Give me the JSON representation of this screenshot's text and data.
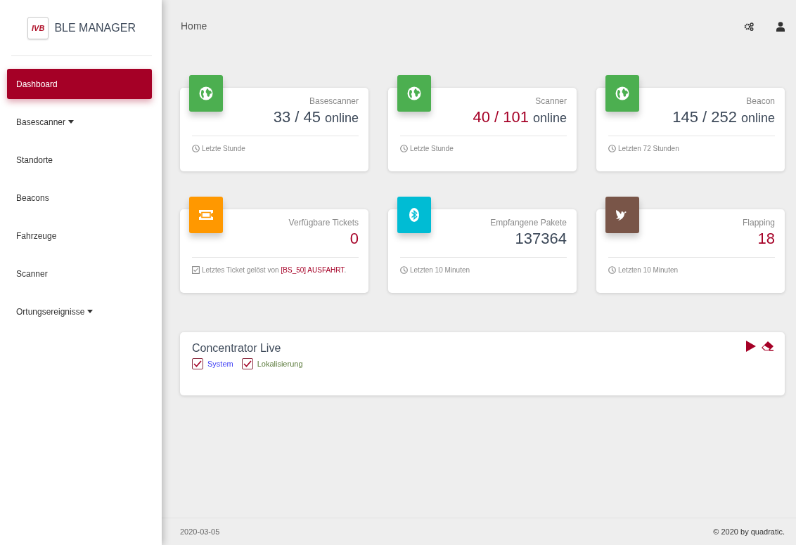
{
  "brand": {
    "logo": "IVB",
    "title": "BLE MANAGER"
  },
  "sidebar": {
    "items": [
      {
        "label": "Dashboard",
        "selected": true,
        "dropdown": false
      },
      {
        "label": "Basescanner",
        "selected": false,
        "dropdown": true
      },
      {
        "label": "Standorte",
        "selected": false,
        "dropdown": false
      },
      {
        "label": "Beacons",
        "selected": false,
        "dropdown": false
      },
      {
        "label": "Fahrzeuge",
        "selected": false,
        "dropdown": false
      },
      {
        "label": "Scanner",
        "selected": false,
        "dropdown": false
      },
      {
        "label": "Ortungsereignisse",
        "selected": false,
        "dropdown": true
      }
    ]
  },
  "header": {
    "title": "Home"
  },
  "cards": [
    {
      "kind": "globe",
      "color": "#4caf50",
      "title": "Basescanner",
      "value": "33 / 45",
      "unit": "online",
      "alert": false,
      "footer": {
        "kind": "clock",
        "text": "Letzte Stunde"
      }
    },
    {
      "kind": "globe",
      "color": "#4caf50",
      "title": "Scanner",
      "value": "40 / 101",
      "unit": "online",
      "alert": true,
      "footer": {
        "kind": "clock",
        "text": "Letzte Stunde"
      }
    },
    {
      "kind": "globe",
      "color": "#4caf50",
      "title": "Beacon",
      "value": "145 / 252",
      "unit": "online",
      "alert": false,
      "footer": {
        "kind": "clock",
        "text": "Letzten 72 Stunden"
      }
    },
    {
      "kind": "ticket",
      "color": "#ff9800",
      "title": "Verfügbare Tickets",
      "value": "0",
      "alert": true,
      "footer": {
        "kind": "check",
        "text": "Letztes Ticket gelöst von",
        "highlight": "[BS_50] AUSFAHRT",
        "after": "."
      }
    },
    {
      "kind": "bluetooth",
      "color": "#00bcd4",
      "title": "Empfangene Pakete",
      "value": "137364",
      "alert": false,
      "footer": {
        "kind": "clock",
        "text": "Letzten 10 Minuten"
      }
    },
    {
      "kind": "dove",
      "color": "#795548",
      "title": "Flapping",
      "value": "18",
      "alert": true,
      "footer": {
        "kind": "clock",
        "text": "Letzten 10 Minuten"
      }
    }
  ],
  "live": {
    "title": "Concentrator Live",
    "filters": [
      {
        "label": "System",
        "checked": true,
        "color": "#3f3ff5"
      },
      {
        "label": "Lokalisierung",
        "checked": true,
        "color": "#5a7a3a"
      }
    ]
  },
  "footer": {
    "date": "2020-03-05",
    "copyright": "© 2020 by quadratic."
  }
}
